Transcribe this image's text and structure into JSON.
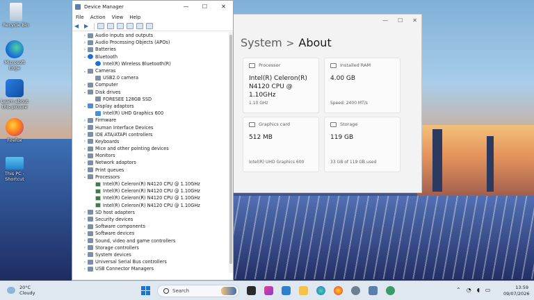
{
  "desktop": {
    "icons": [
      {
        "label": "Recycle Bin",
        "icon": "recycle-bin-icon"
      },
      {
        "label": "Microsoft Edge",
        "icon": "edge-icon"
      },
      {
        "label": "Learn about this picture",
        "icon": "learn-picture-icon"
      },
      {
        "label": "Firefox",
        "icon": "firefox-icon"
      },
      {
        "label": "This PC - Shortcut",
        "icon": "this-pc-icon"
      }
    ]
  },
  "settings": {
    "breadcrumb_parent": "System",
    "breadcrumb_separator": ">",
    "breadcrumb_current": "About",
    "cards": [
      {
        "title": "Processor",
        "value": "Intel(R) Celeron(R) N4120 CPU @ 1.10GHz",
        "sub": "1.10 GHz"
      },
      {
        "title": "Installed RAM",
        "value": "4.00 GB",
        "sub": "Speed: 2400 MT/s"
      },
      {
        "title": "Graphics card",
        "value": "512 MB",
        "sub": "Intel(R) UHD Graphics 600"
      },
      {
        "title": "Storage",
        "value": "119 GB",
        "sub": "33 GB of 119 GB used"
      }
    ]
  },
  "device_manager": {
    "title": "Device Manager",
    "menu": [
      "File",
      "Action",
      "View",
      "Help"
    ],
    "tree": [
      {
        "label": "Audio inputs and outputs",
        "level": 0,
        "expanded": false
      },
      {
        "label": "Audio Processing Objects (APOs)",
        "level": 0,
        "expanded": false
      },
      {
        "label": "Batteries",
        "level": 0,
        "expanded": false
      },
      {
        "label": "Bluetooth",
        "level": 0,
        "expanded": true
      },
      {
        "label": "Intel(R) Wireless Bluetooth(R)",
        "level": 1
      },
      {
        "label": "Cameras",
        "level": 0,
        "expanded": true
      },
      {
        "label": "USB2.0 camera",
        "level": 1
      },
      {
        "label": "Computer",
        "level": 0,
        "expanded": false
      },
      {
        "label": "Disk drives",
        "level": 0,
        "expanded": true
      },
      {
        "label": "FORESEE 128GB SSD",
        "level": 1
      },
      {
        "label": "Display adaptors",
        "level": 0,
        "expanded": true
      },
      {
        "label": "Intel(R) UHD Graphics 600",
        "level": 1
      },
      {
        "label": "Firmware",
        "level": 0,
        "expanded": false
      },
      {
        "label": "Human Interface Devices",
        "level": 0,
        "expanded": false
      },
      {
        "label": "IDE ATA/ATAPI controllers",
        "level": 0,
        "expanded": false
      },
      {
        "label": "Keyboards",
        "level": 0,
        "expanded": false
      },
      {
        "label": "Mice and other pointing devices",
        "level": 0,
        "expanded": false
      },
      {
        "label": "Monitors",
        "level": 0,
        "expanded": false
      },
      {
        "label": "Network adaptors",
        "level": 0,
        "expanded": false
      },
      {
        "label": "Print queues",
        "level": 0,
        "expanded": false
      },
      {
        "label": "Processors",
        "level": 0,
        "expanded": true
      },
      {
        "label": "Intel(R) Celeron(R) N4120 CPU @ 1.10GHz",
        "level": 1
      },
      {
        "label": "Intel(R) Celeron(R) N4120 CPU @ 1.10GHz",
        "level": 1
      },
      {
        "label": "Intel(R) Celeron(R) N4120 CPU @ 1.10GHz",
        "level": 1
      },
      {
        "label": "Intel(R) Celeron(R) N4120 CPU @ 1.10GHz",
        "level": 1
      },
      {
        "label": "SD host adapters",
        "level": 0,
        "expanded": false
      },
      {
        "label": "Security devices",
        "level": 0,
        "expanded": false
      },
      {
        "label": "Software components",
        "level": 0,
        "expanded": false
      },
      {
        "label": "Software devices",
        "level": 0,
        "expanded": false
      },
      {
        "label": "Sound, video and game controllers",
        "level": 0,
        "expanded": false
      },
      {
        "label": "Storage controllers",
        "level": 0,
        "expanded": false
      },
      {
        "label": "System devices",
        "level": 0,
        "expanded": false
      },
      {
        "label": "Universal Serial Bus controllers",
        "level": 0,
        "expanded": false
      },
      {
        "label": "USB Connector Managers",
        "level": 0,
        "expanded": false
      }
    ]
  },
  "taskbar": {
    "weather_temp": "20°C",
    "weather_desc": "Cloudy",
    "search_placeholder": "Search",
    "time": "13:59",
    "date": "09/07/2026"
  }
}
